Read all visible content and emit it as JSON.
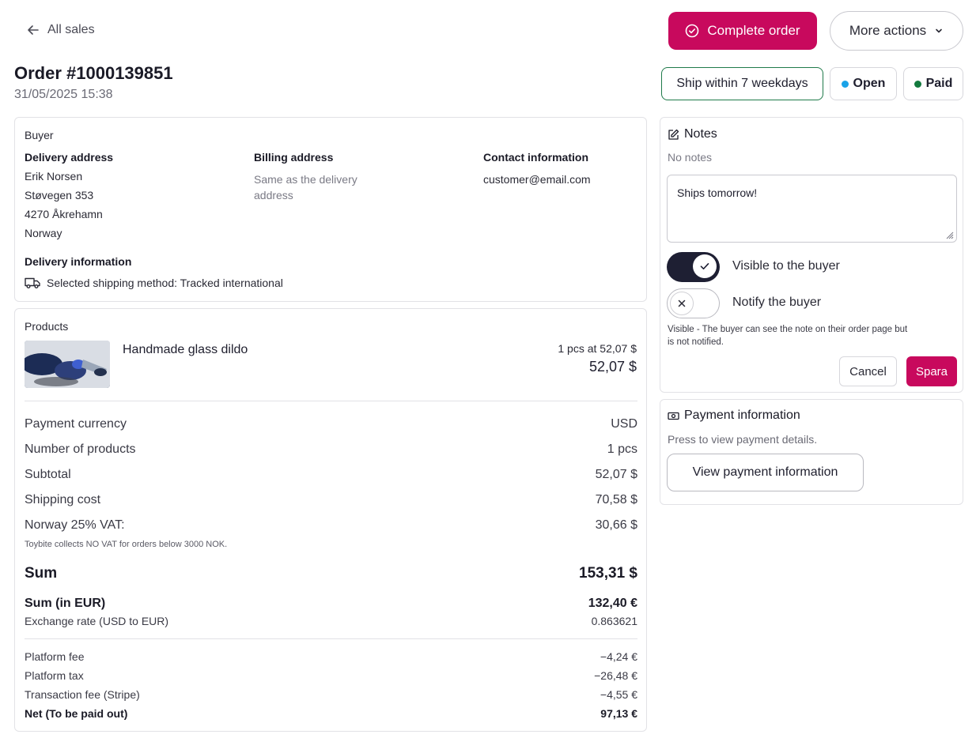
{
  "header": {
    "back_label": "All sales",
    "complete_label": "Complete order",
    "more_label": "More actions",
    "order_title": "Order #1000139851",
    "order_date": "31/05/2025 15:38"
  },
  "badges": {
    "ship": "Ship within 7 weekdays",
    "open": "Open",
    "paid": "Paid",
    "open_color": "#1aa3e8",
    "paid_color": "#137a3e"
  },
  "buyer": {
    "section_label": "Buyer",
    "delivery_heading": "Delivery address",
    "delivery_lines": [
      "Erik Norsen",
      "Støvegen 353",
      "4270 Åkrehamn",
      "Norway"
    ],
    "billing_heading": "Billing address",
    "billing_lines": [
      "Same as the delivery",
      "address"
    ],
    "contact_heading": "Contact information",
    "contact_email": "customer@email.com",
    "delivery_info_heading": "Delivery information",
    "shipping_method": "Selected shipping method: Tracked international"
  },
  "products": {
    "section_label": "Products",
    "items": [
      {
        "name": "Handmade glass dildo",
        "qty_price": "1 pcs at 52,07 $",
        "total": "52,07 $"
      }
    ],
    "summary": [
      {
        "label": "Payment currency",
        "value": "USD"
      },
      {
        "label": "Number of products",
        "value": "1 pcs"
      },
      {
        "label": "Subtotal",
        "value": "52,07 $"
      },
      {
        "label": "Shipping cost",
        "value": "70,58 $"
      },
      {
        "label": "Norway 25% VAT:",
        "value": "30,66 $"
      }
    ],
    "vat_note": "Toybite collects NO VAT for orders below 3000 NOK.",
    "sum_label": "Sum",
    "sum_value": "153,31 $",
    "sum_eur_label": "Sum (in EUR)",
    "sum_eur_value": "132,40 €",
    "exchange_label": "Exchange rate (USD to EUR)",
    "exchange_value": "0.863621",
    "fees": [
      {
        "label": "Platform fee",
        "value": "−4,24 €"
      },
      {
        "label": "Platform tax",
        "value": "−26,48 €"
      },
      {
        "label": "Transaction fee (Stripe)",
        "value": "−4,55 €"
      }
    ],
    "net_label": "Net (To be paid out)",
    "net_value": "97,13 €"
  },
  "notes": {
    "heading": "Notes",
    "empty_text": "No notes",
    "note_value": "Ships tomorrow!",
    "visible_label": "Visible to the buyer",
    "visible_on": true,
    "notify_label": "Notify the buyer",
    "notify_on": false,
    "hint_line1": "Visible - The buyer can see the note on their order page but",
    "hint_line2": "is not notified.",
    "cancel_label": "Cancel",
    "save_label": "Spara"
  },
  "payment": {
    "heading": "Payment information",
    "hint": "Press to view payment details.",
    "view_label": "View payment information"
  },
  "colors": {
    "accent": "#c8095d",
    "dark_toggle": "#1e1f33",
    "ship_border": "#1f7a4a"
  }
}
